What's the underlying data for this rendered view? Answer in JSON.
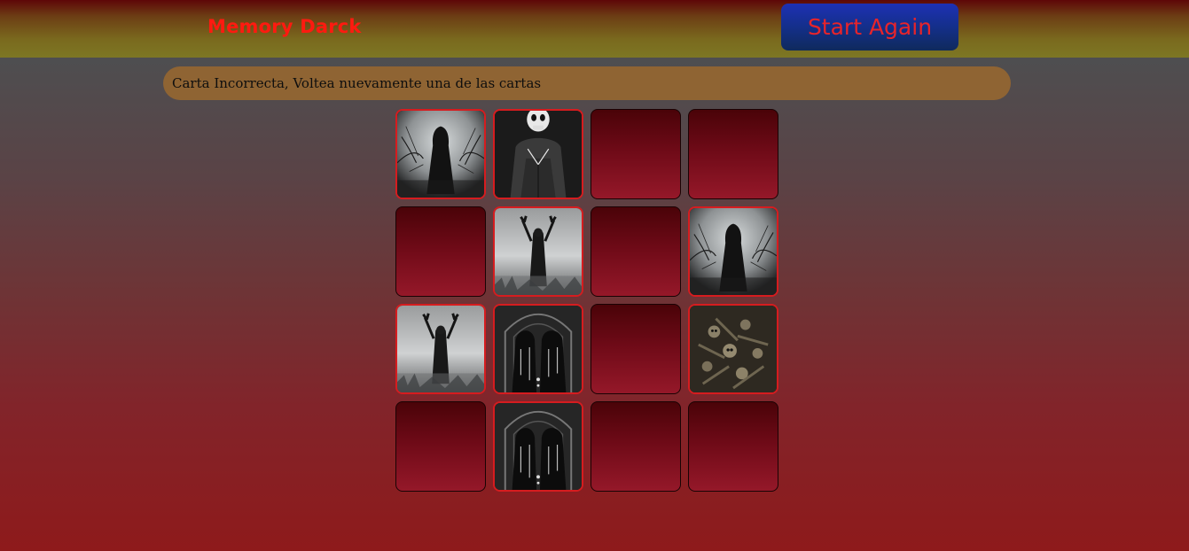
{
  "header": {
    "title": "Memory Darck",
    "restart_label": "Start Again"
  },
  "status": {
    "message": "Carta Incorrecta, Voltea nuevamente una de las cartas"
  },
  "colors": {
    "card_back": "#7a0d1b",
    "card_face_border": "#d61c1f",
    "title": "#ff1a10",
    "status_bar": "#8f6433"
  },
  "board": {
    "columns": 4,
    "rows": 4,
    "cards": [
      {
        "state": "face-up",
        "image": "hooded-figure-forest"
      },
      {
        "state": "face-up",
        "image": "skull-hoodie"
      },
      {
        "state": "face-down",
        "image": ""
      },
      {
        "state": "face-down",
        "image": ""
      },
      {
        "state": "face-down",
        "image": ""
      },
      {
        "state": "face-up",
        "image": "arms-raised-fog"
      },
      {
        "state": "face-down",
        "image": ""
      },
      {
        "state": "face-up",
        "image": "hooded-figure-forest"
      },
      {
        "state": "face-up",
        "image": "arms-raised-fog"
      },
      {
        "state": "face-up",
        "image": "reapers-gate"
      },
      {
        "state": "face-down",
        "image": ""
      },
      {
        "state": "face-up",
        "image": "skeleton-pile"
      },
      {
        "state": "face-down",
        "image": ""
      },
      {
        "state": "face-up",
        "image": "reapers-gate"
      },
      {
        "state": "face-down",
        "image": ""
      },
      {
        "state": "face-down",
        "image": ""
      }
    ]
  }
}
